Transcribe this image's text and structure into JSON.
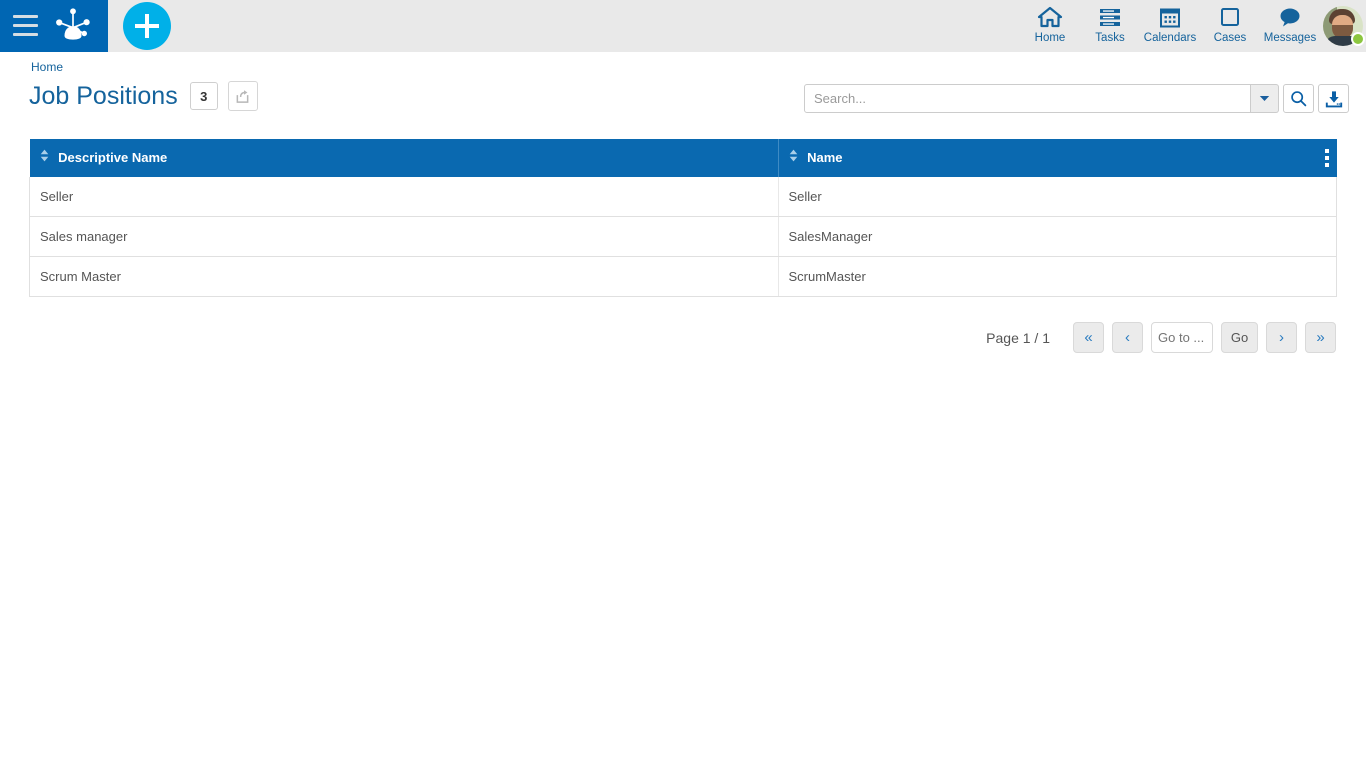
{
  "topbar": {
    "menu_icon": "hamburger-icon",
    "logo_icon": "frog-footprint-logo",
    "add_icon": "plus-icon",
    "nav": [
      {
        "label": "Home",
        "icon": "home-icon"
      },
      {
        "label": "Tasks",
        "icon": "tasks-icon"
      },
      {
        "label": "Calendars",
        "icon": "calendar-icon"
      },
      {
        "label": "Cases",
        "icon": "square-icon"
      },
      {
        "label": "Messages",
        "icon": "chat-bubble-icon"
      }
    ],
    "avatar": {
      "name": "avatar",
      "status": "online"
    }
  },
  "breadcrumb": {
    "home": "Home"
  },
  "header": {
    "title": "Job Positions",
    "count": "3",
    "share_icon": "share-export-icon"
  },
  "search": {
    "value": "",
    "placeholder": "Search...",
    "dropdown_icon": "chevron-down-icon",
    "search_icon": "magnifier-icon",
    "import_icon": "download-import-icon"
  },
  "table": {
    "columns": [
      {
        "label": "Descriptive Name",
        "sort_icon": "sort-updown-icon"
      },
      {
        "label": "Name",
        "sort_icon": "sort-updown-icon"
      }
    ],
    "menu_icon": "kebab-menu-icon",
    "rows": [
      {
        "descriptive_name": "Seller",
        "name": "Seller"
      },
      {
        "descriptive_name": "Sales manager",
        "name": "SalesManager"
      },
      {
        "descriptive_name": "Scrum Master",
        "name": "ScrumMaster"
      }
    ]
  },
  "pagination": {
    "page_label": "Page 1 / 1",
    "first_label": "«",
    "prev_label": "‹",
    "goto_value": "",
    "goto_placeholder": "Go to ...",
    "go_label": "Go",
    "next_label": "›",
    "last_label": "»"
  },
  "colors": {
    "brand_blue": "#0066b3",
    "table_header_blue": "#0a69b0",
    "accent_cyan": "#00b0e8",
    "link_blue": "#15639c",
    "status_green": "#8cc63f",
    "topbar_bg": "#e9e9e9"
  }
}
